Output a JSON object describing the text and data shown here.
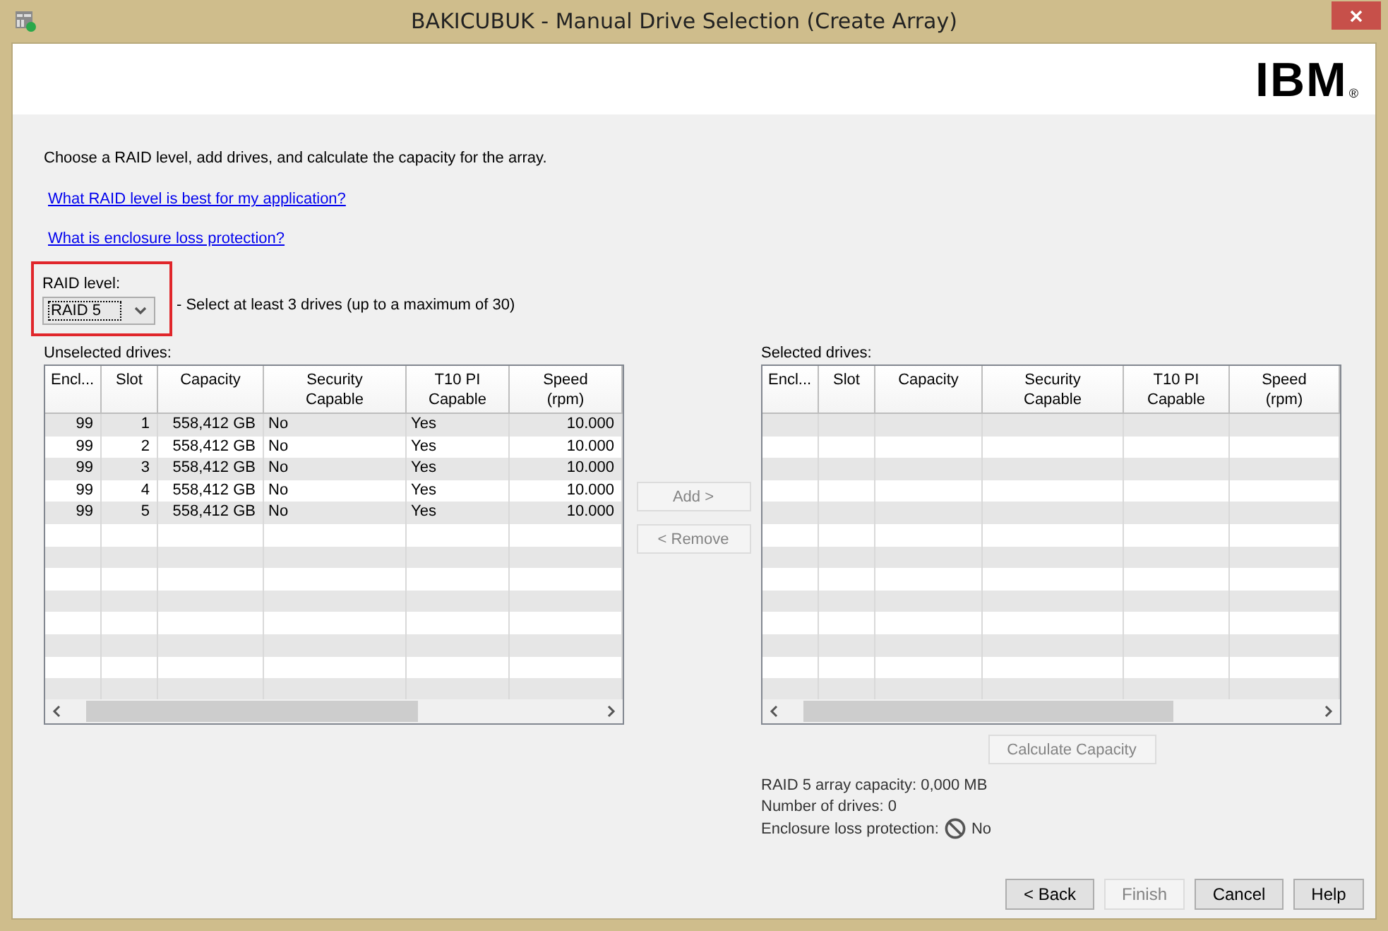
{
  "window": {
    "title": "BAKICUBUK - Manual Drive Selection (Create Array)"
  },
  "logo": {
    "text": "IBM",
    "mark": "®"
  },
  "instruction": "Choose a RAID level, add drives, and calculate the capacity for the array.",
  "links": [
    "What RAID level is best for my application?",
    "What is enclosure loss protection?"
  ],
  "raid_level": {
    "label": "RAID level:",
    "value": "RAID 5",
    "highlighted": true,
    "hint": "- Select at least 3 drives (up to a maximum of 30)"
  },
  "unselected_table": {
    "label": "Unselected drives:",
    "columns": [
      "Encl...",
      "Slot",
      "Capacity",
      "Security Capable",
      "T10 PI Capable",
      "Speed (rpm)"
    ],
    "rows": [
      [
        "99",
        "1",
        "558,412 GB",
        "No",
        "Yes",
        "10.000"
      ],
      [
        "99",
        "2",
        "558,412 GB",
        "No",
        "Yes",
        "10.000"
      ],
      [
        "99",
        "3",
        "558,412 GB",
        "No",
        "Yes",
        "10.000"
      ],
      [
        "99",
        "4",
        "558,412 GB",
        "No",
        "Yes",
        "10.000"
      ],
      [
        "99",
        "5",
        "558,412 GB",
        "No",
        "Yes",
        "10.000"
      ]
    ]
  },
  "move_buttons": [
    {
      "label": "Add >",
      "disabled": true
    },
    {
      "label": "< Remove",
      "disabled": true
    }
  ],
  "selected_table": {
    "label": "Selected drives:",
    "columns": [
      "Encl...",
      "Slot",
      "Capacity",
      "Security Capable",
      "T10 PI Capable",
      "Speed (rpm)"
    ]
  },
  "calculate_button": {
    "label": "Calculate Capacity",
    "disabled": true
  },
  "summary": {
    "capacity": "RAID 5 array capacity: 0,000 MB",
    "drives": "Number of drives: 0",
    "protection_label": "Enclosure loss protection:",
    "protection_value": "No"
  },
  "footer_buttons": [
    {
      "label": "< Back",
      "disabled": false
    },
    {
      "label": "Finish",
      "disabled": true
    },
    {
      "label": "Cancel",
      "disabled": false
    },
    {
      "label": "Help",
      "disabled": false
    }
  ]
}
